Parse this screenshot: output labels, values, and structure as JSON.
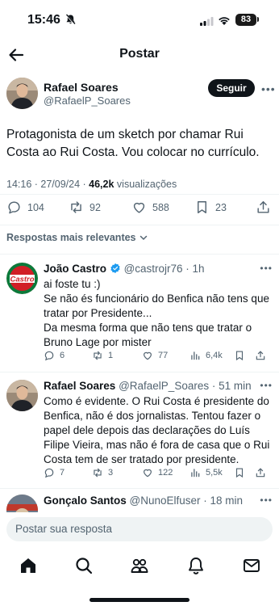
{
  "status_bar": {
    "time": "15:46",
    "battery": "83"
  },
  "nav": {
    "title": "Postar"
  },
  "post": {
    "author_name": "Rafael Soares",
    "author_handle": "@RafaelP_Soares",
    "follow_label": "Seguir",
    "text": "Protagonista de um sketch por chamar Rui Costa ao Rui Costa. Vou colocar no currículo.",
    "timestamp": "14:16 · 27/09/24 · ",
    "views_count": "46,2k",
    "views_label": " visualizações",
    "replies": "104",
    "reposts": "92",
    "likes": "588",
    "bookmarks": "23"
  },
  "sort_label": "Respostas mais relevantes",
  "replies": [
    {
      "name": "João Castro",
      "handle": "@castrojr76",
      "time": " · 1h",
      "avatar_text": "Castro",
      "text_lines": [
        "ai foste tu :)",
        "Se não és funcionário do Benfica não tens que",
        "tratar por Presidente...",
        "Da mesma forma que não tens que tratar o",
        "Bruno Lage por mister"
      ],
      "replies": "6",
      "reposts": "1",
      "likes": "77",
      "views": "6,4k"
    },
    {
      "name": "Rafael Soares",
      "handle": "@RafaelP_Soares",
      "time": " · 51 min",
      "text_lines": [
        "Como é evidente. O Rui Costa é presidente do",
        "Benfica, não é dos jornalistas. Tentou fazer o",
        "papel dele depois das declarações do Luís",
        "Filipe Vieira, mas não é fora de casa que o Rui",
        "Costa tem de ser tratado por presidente."
      ],
      "replies": "7",
      "reposts": "3",
      "likes": "122",
      "views": "5,5k"
    },
    {
      "name": "Gonçalo Santos",
      "handle": "@NunoElfuser",
      "time": " · 18 min"
    }
  ],
  "compose_placeholder": "Postar sua resposta",
  "tabs": [
    "home-icon",
    "search-icon",
    "communities-icon",
    "notifications-icon",
    "messages-icon"
  ],
  "colors": {
    "verified": "#1d9bf0",
    "text": "#0f1419",
    "muted": "#536471",
    "divider": "#eff3f4",
    "castro_red": "#d11f26",
    "castro_green": "#0b7a3b"
  }
}
